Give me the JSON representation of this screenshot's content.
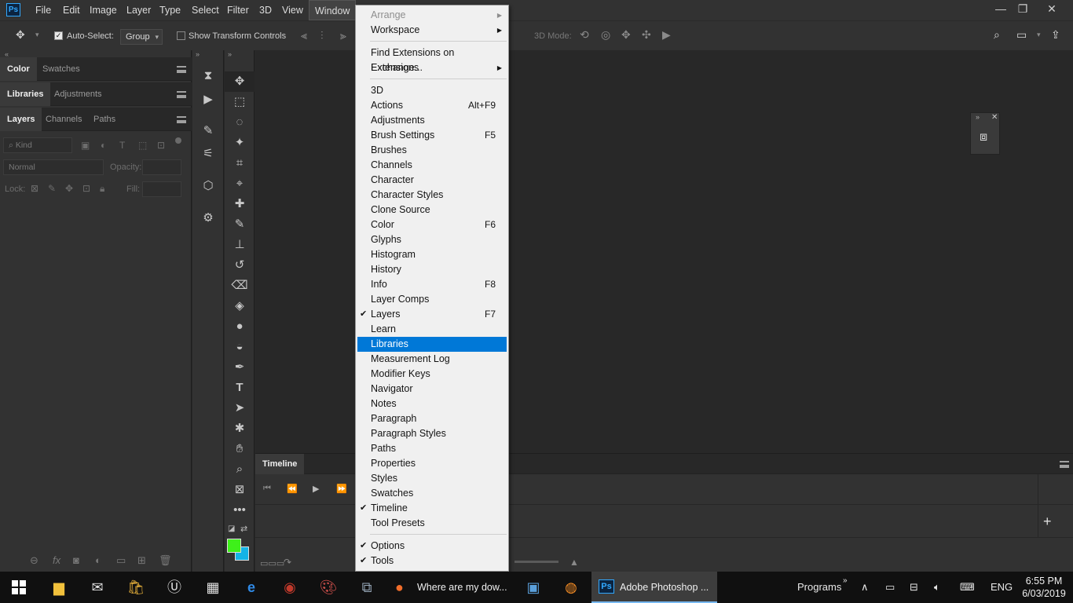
{
  "app": {
    "logo": "Ps",
    "menus": [
      "File",
      "Edit",
      "Image",
      "Layer",
      "Type",
      "Select",
      "Filter",
      "3D",
      "View",
      "Window"
    ],
    "window_controls": {
      "minimize": "—",
      "restore": "❐",
      "close": "✕"
    }
  },
  "options": {
    "auto_select_label": "Auto-Select:",
    "group_value": "Group",
    "show_transform_label": "Show Transform Controls",
    "mode_3d_label": "3D Mode:"
  },
  "left_panel": {
    "tabs_row1": [
      "Color",
      "Swatches"
    ],
    "tabs_row2": [
      "Libraries",
      "Adjustments"
    ],
    "tabs_row3": [
      "Layers",
      "Channels",
      "Paths"
    ],
    "kind_placeholder": "Kind",
    "blend_mode": "Normal",
    "opacity_label": "Opacity:",
    "lock_label": "Lock:",
    "fill_label": "Fill:"
  },
  "timeline": {
    "tab_label": "Timeline"
  },
  "window_menu": {
    "items": [
      {
        "label": "Arrange",
        "disabled": true,
        "submenu": true
      },
      {
        "label": "Workspace",
        "submenu": true
      },
      {
        "sep": true
      },
      {
        "label": "Find Extensions on Exchange..."
      },
      {
        "label": "Extensions",
        "submenu": true
      },
      {
        "sep": true
      },
      {
        "label": "3D"
      },
      {
        "label": "Actions",
        "shortcut": "Alt+F9"
      },
      {
        "label": "Adjustments"
      },
      {
        "label": "Brush Settings",
        "shortcut": "F5"
      },
      {
        "label": "Brushes"
      },
      {
        "label": "Channels"
      },
      {
        "label": "Character"
      },
      {
        "label": "Character Styles"
      },
      {
        "label": "Clone Source"
      },
      {
        "label": "Color",
        "shortcut": "F6"
      },
      {
        "label": "Glyphs"
      },
      {
        "label": "Histogram"
      },
      {
        "label": "History"
      },
      {
        "label": "Info",
        "shortcut": "F8"
      },
      {
        "label": "Layer Comps"
      },
      {
        "label": "Layers",
        "shortcut": "F7",
        "checked": true
      },
      {
        "label": "Learn"
      },
      {
        "label": "Libraries",
        "selected": true
      },
      {
        "label": "Measurement Log"
      },
      {
        "label": "Modifier Keys"
      },
      {
        "label": "Navigator"
      },
      {
        "label": "Notes"
      },
      {
        "label": "Paragraph"
      },
      {
        "label": "Paragraph Styles"
      },
      {
        "label": "Paths"
      },
      {
        "label": "Properties"
      },
      {
        "label": "Styles"
      },
      {
        "label": "Swatches"
      },
      {
        "label": "Timeline",
        "checked": true
      },
      {
        "label": "Tool Presets"
      },
      {
        "sep": true
      },
      {
        "label": "Options",
        "checked": true
      },
      {
        "label": "Tools",
        "checked": true
      }
    ]
  },
  "taskbar": {
    "firefox_title": "Where are my dow...",
    "photoshop_title": "Adobe Photoshop ...",
    "programs_label": "Programs",
    "language": "ENG",
    "time": "6:55 PM",
    "date": "6/03/2019"
  },
  "colors": {
    "menu_highlight": "#0078d7",
    "foreground_swatch": "#3ef01a",
    "background_swatch": "#14b4e6",
    "ps_blue": "#31a8ff"
  }
}
